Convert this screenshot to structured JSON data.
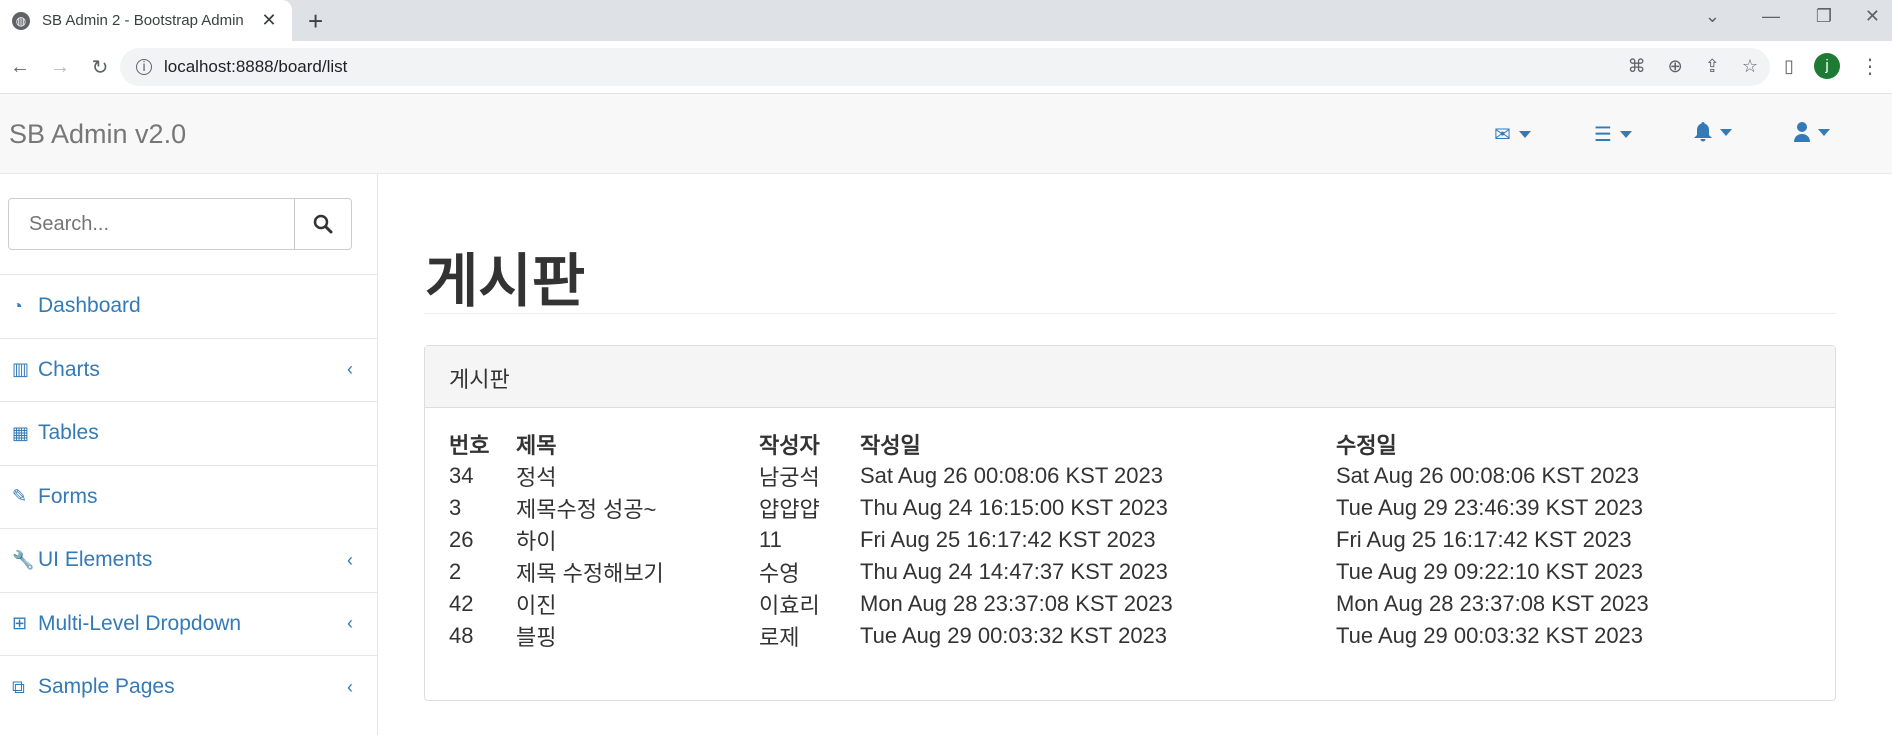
{
  "browser": {
    "tab_title": "SB Admin 2 - Bootstrap Admin",
    "url": "localhost:8888/board/list",
    "avatar_letter": "j"
  },
  "app": {
    "brand": "SB Admin v2.0"
  },
  "sidebar": {
    "search_placeholder": "Search...",
    "items": [
      {
        "label": "Dashboard",
        "icon": "dashboard-icon",
        "has_children": false
      },
      {
        "label": "Charts",
        "icon": "bar-chart-icon",
        "has_children": true
      },
      {
        "label": "Tables",
        "icon": "table-icon",
        "has_children": false
      },
      {
        "label": "Forms",
        "icon": "edit-icon",
        "has_children": false
      },
      {
        "label": "UI Elements",
        "icon": "wrench-icon",
        "has_children": true
      },
      {
        "label": "Multi-Level Dropdown",
        "icon": "sitemap-icon",
        "has_children": true
      },
      {
        "label": "Sample Pages",
        "icon": "files-icon",
        "has_children": true
      }
    ]
  },
  "main": {
    "page_title": "게시판",
    "panel_heading": "게시판",
    "table": {
      "headers": [
        "번호",
        "제목",
        "작성자",
        "작성일",
        "수정일"
      ],
      "rows": [
        [
          "34",
          "정석",
          "남궁석",
          "Sat Aug 26 00:08:06 KST 2023",
          "Sat Aug 26 00:08:06 KST 2023"
        ],
        [
          "3",
          "제목수정 성공~",
          "얍얍얍",
          "Thu Aug 24 16:15:00 KST 2023",
          "Tue Aug 29 23:46:39 KST 2023"
        ],
        [
          "26",
          "하이",
          "11",
          "Fri Aug 25 16:17:42 KST 2023",
          "Fri Aug 25 16:17:42 KST 2023"
        ],
        [
          "2",
          "제목 수정해보기",
          "수영",
          "Thu Aug 24 14:47:37 KST 2023",
          "Tue Aug 29 09:22:10 KST 2023"
        ],
        [
          "42",
          "이진",
          "이효리",
          "Mon Aug 28 23:37:08 KST 2023",
          "Mon Aug 28 23:37:08 KST 2023"
        ],
        [
          "48",
          "블핑",
          "로제",
          "Tue Aug 29 00:03:32 KST 2023",
          "Tue Aug 29 00:03:32 KST 2023"
        ]
      ]
    }
  },
  "colors": {
    "link": "#337ab7",
    "navbar_bg": "#f8f8f8",
    "panel_head_bg": "#f5f5f5"
  }
}
